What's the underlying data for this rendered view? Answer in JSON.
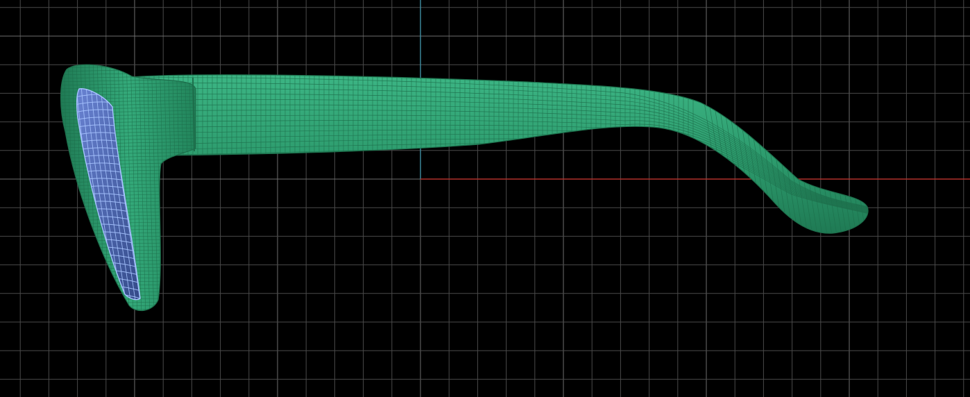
{
  "viewport": {
    "projection": "orthographic-side",
    "background_color": "#000000",
    "grid_visible": true,
    "grid_color": "#4a4a4a",
    "grid_major_color": "#6e6e6e",
    "axis_x_color": "#b0302a",
    "axis_y_color": "#3f8ea3"
  },
  "model": {
    "object": "sunglasses-frame",
    "display_mode": "wireframe-on-shaded",
    "frame_color": "#2c9a6c",
    "frame_wire_color": "#1d6e4b",
    "lens_color": "#4b5fa8",
    "lens_wire_color": "#a7c4ff"
  }
}
